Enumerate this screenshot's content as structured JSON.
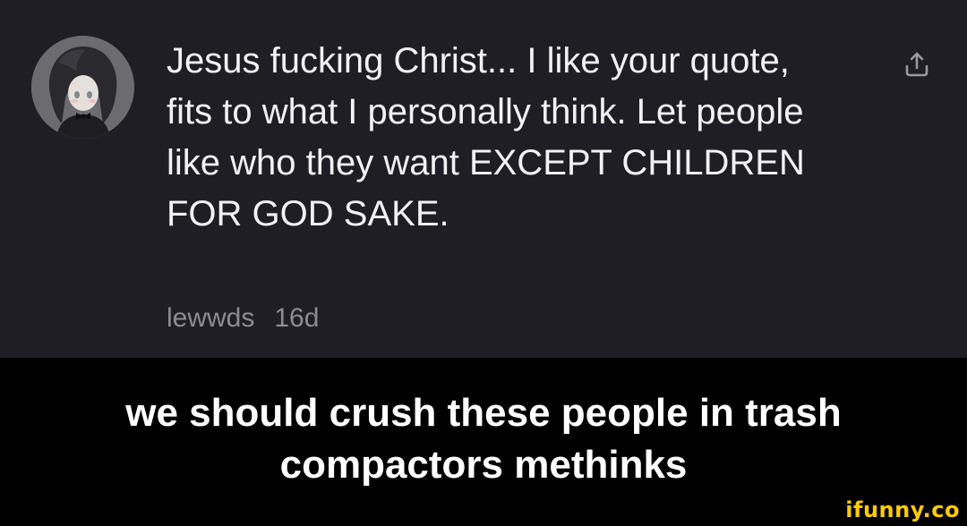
{
  "comment": {
    "text": "Jesus fucking Christ... I like your quote, fits to what I personally think. Let people like who they want EXCEPT CHILDREN FOR GOD SAKE.",
    "username": "lewwds",
    "time": "16d",
    "share_icon": "share-icon",
    "avatar_icon": "avatar"
  },
  "caption": {
    "text": "we should crush these people in trash compactors methinks"
  },
  "watermark": {
    "text": "ifunny.co"
  },
  "colors": {
    "panel_background": "#1f1e24",
    "caption_background": "#000000",
    "comment_text": "#f2f2f4",
    "meta_text": "#8d8c93",
    "watermark": "#ffcc00"
  }
}
